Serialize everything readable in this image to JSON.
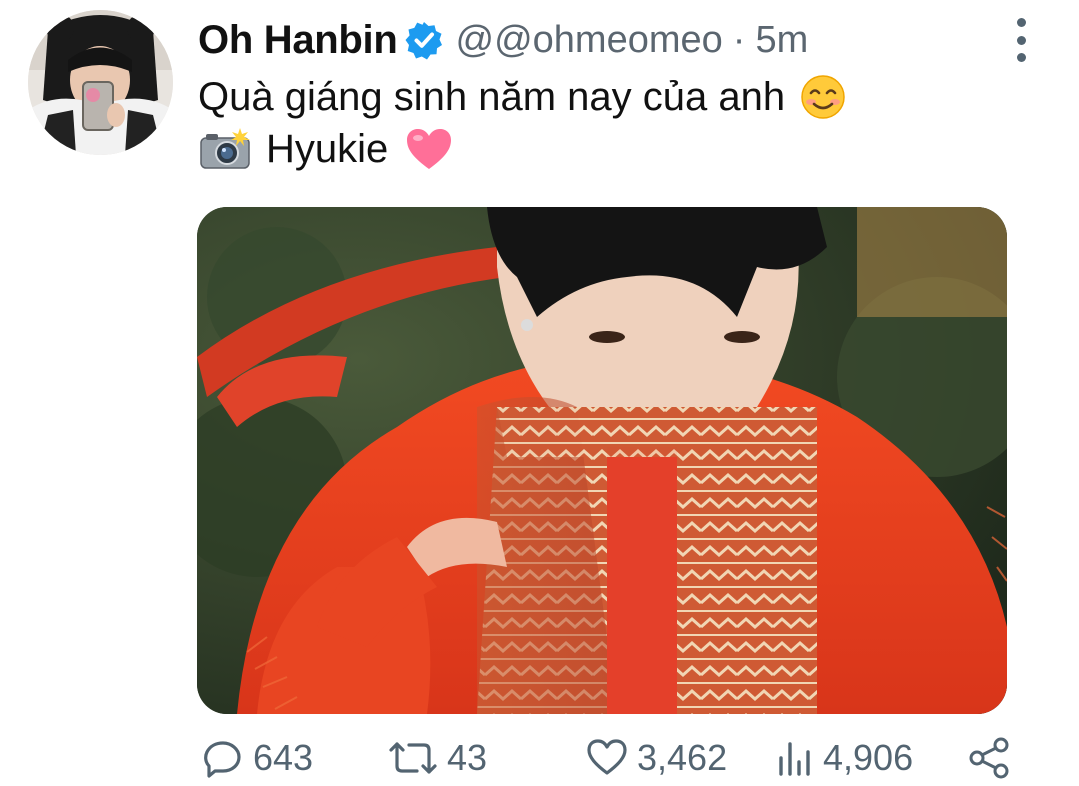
{
  "tweet": {
    "author_name": "Oh Hanbin",
    "handle": "@@ohmeomeo",
    "separator": "·",
    "time": "5m",
    "text_line1": "Quà giáng sinh năm nay của anh",
    "text_line2": "Hyukie",
    "emojis": [
      "smiling-face-emoji",
      "camera-flash-emoji",
      "pink-heart-emoji"
    ]
  },
  "stats": {
    "replies": "643",
    "retweets": "43",
    "likes": "3,462",
    "views": "4,906"
  },
  "colors": {
    "verified_blue": "#1d9bf0",
    "secondary_text": "#536471",
    "primary_text": "#0f1419"
  }
}
